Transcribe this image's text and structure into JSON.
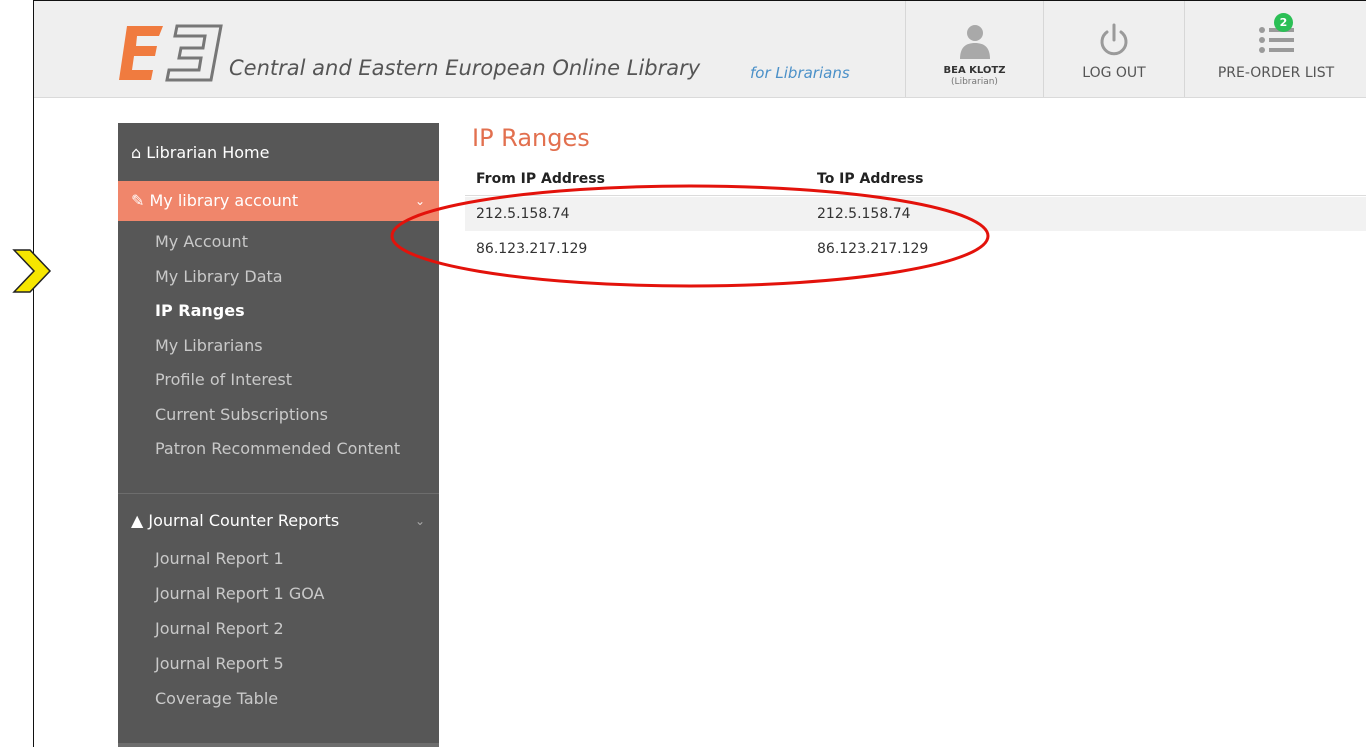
{
  "header": {
    "site_title": "Central and Eastern European Online Library",
    "site_subtitle": "for Librarians",
    "user_name": "BEA KLOTZ",
    "user_role": "(Librarian)",
    "logout_label": "LOG OUT",
    "preorder_label": "PRE-ORDER LIST",
    "preorder_count": "2",
    "brand_color": "#f07b3f"
  },
  "sidebar": {
    "home_label": "Librarian Home",
    "section_label": "My library account",
    "items": [
      "My Account",
      "My Library Data",
      "IP Ranges",
      "My Librarians",
      "Profile of Interest",
      "Current Subscriptions",
      "Patron Recommended Content"
    ],
    "current_item": "IP Ranges",
    "journal_label": "Journal Counter Reports",
    "journal_items": [
      "Journal Report 1",
      "Journal Report 1 GOA",
      "Journal Report 2",
      "Journal Report 5",
      "Coverage Table"
    ]
  },
  "main": {
    "title": "IP Ranges",
    "columns": [
      "From IP Address",
      "To IP Address"
    ],
    "rows": [
      [
        "212.5.158.74",
        "212.5.158.74"
      ],
      [
        "86.123.217.129",
        "86.123.217.129"
      ]
    ]
  }
}
